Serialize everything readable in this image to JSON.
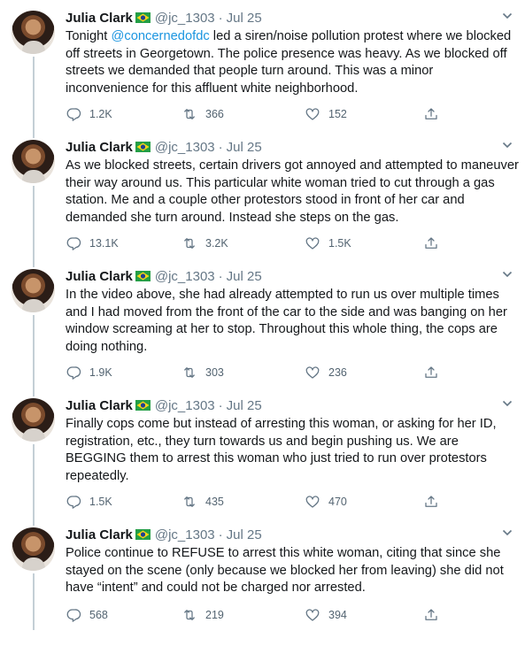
{
  "tweets": [
    {
      "name": "Julia Clark",
      "handle": "@jc_1303",
      "date": "Jul 25",
      "text_before": "Tonight ",
      "mention": "@concernedofdc",
      "text_after": " led a siren/noise pollution protest where we blocked off streets in Georgetown. The police presence was heavy. As we blocked off streets we demanded that people turn around. This was a minor inconvenience for this affluent white neighborhood.",
      "replies": "1.2K",
      "retweets": "366",
      "likes": "152"
    },
    {
      "name": "Julia Clark",
      "handle": "@jc_1303",
      "date": "Jul 25",
      "text": "As we blocked streets, certain drivers got annoyed and attempted to maneuver their way around us. This particular white woman tried to cut through a gas station. Me and a couple other protestors stood in front of her car and demanded she turn around. Instead she steps on the gas.",
      "replies": "13.1K",
      "retweets": "3.2K",
      "likes": "1.5K"
    },
    {
      "name": "Julia Clark",
      "handle": "@jc_1303",
      "date": "Jul 25",
      "text": "In the video above, she had already attempted to run us over multiple times and I had moved from the front of the car to the side and was banging on her window screaming at her to stop. Throughout this whole thing, the cops are doing nothing.",
      "replies": "1.9K",
      "retweets": "303",
      "likes": "236"
    },
    {
      "name": "Julia Clark",
      "handle": "@jc_1303",
      "date": "Jul 25",
      "text": "Finally cops come but instead of arresting this woman, or asking for her ID, registration, etc., they turn towards us and begin pushing us. We are BEGGING them to arrest this woman who just tried to run over protestors repeatedly.",
      "replies": "1.5K",
      "retweets": "435",
      "likes": "470"
    },
    {
      "name": "Julia Clark",
      "handle": "@jc_1303",
      "date": "Jul 25",
      "text": "Police continue to REFUSE to arrest this white woman, citing that since she stayed on the scene (only because we blocked her from leaving) she did not have “intent” and could not be charged nor arrested.",
      "replies": "568",
      "retweets": "219",
      "likes": "394"
    }
  ],
  "colors": {
    "text": "#14171a",
    "muted": "#657786",
    "link": "#1b95e0",
    "thread_line": "#c4cfd6"
  },
  "icons": [
    "chevron-down-icon",
    "reply-icon",
    "retweet-icon",
    "like-icon",
    "share-icon",
    "brazil-flag-icon"
  ]
}
